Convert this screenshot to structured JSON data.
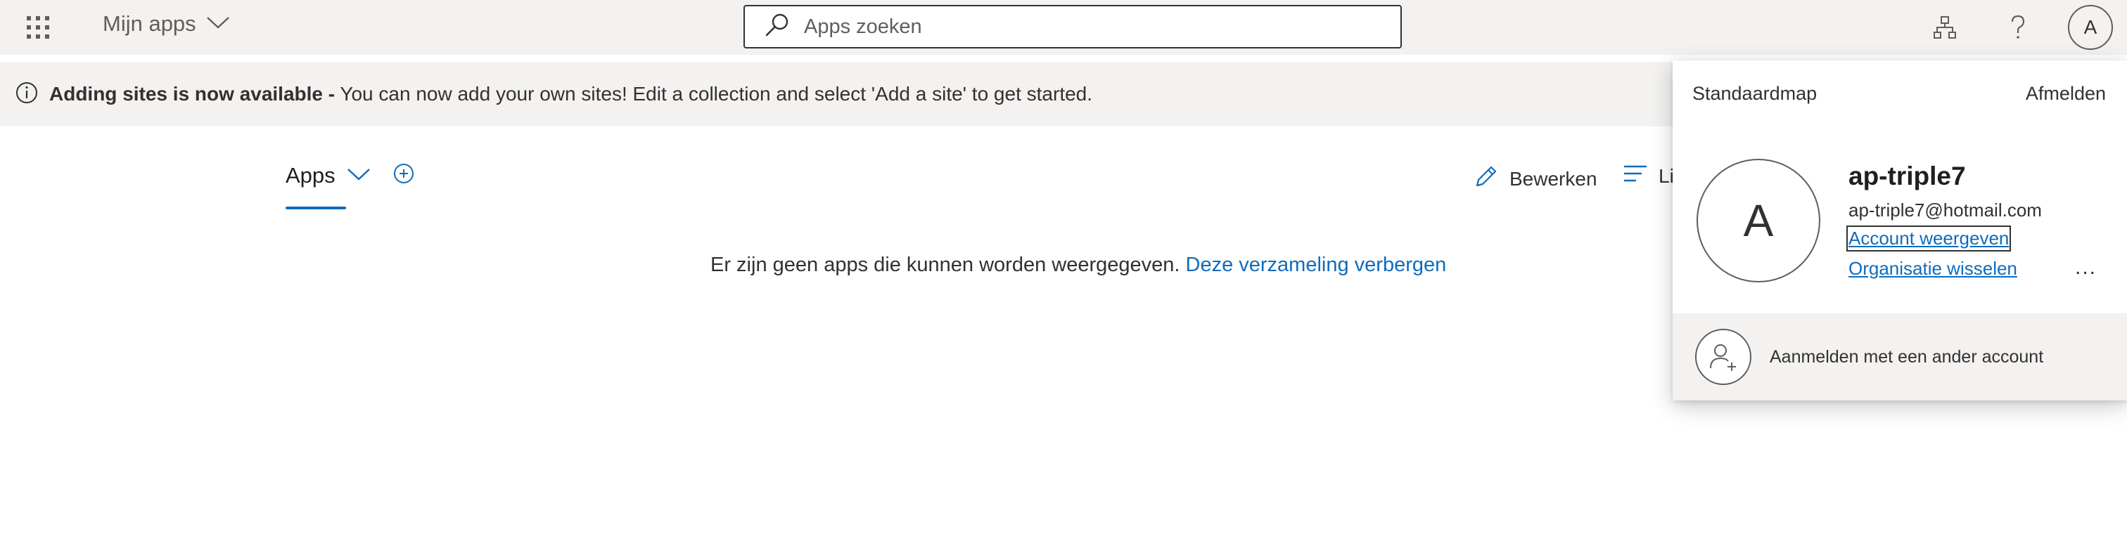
{
  "header": {
    "app_title": "Mijn apps",
    "search_placeholder": "Apps zoeken",
    "avatar_initial": "A",
    "icons": [
      "waffle-icon",
      "chevron-down-icon",
      "search-icon",
      "org-chart-icon",
      "help-icon"
    ]
  },
  "banner": {
    "bold_text": "Adding sites is now available -",
    "text": " You can now add your own sites! Edit a collection and select 'Add a site' to get started."
  },
  "main": {
    "tab_label": "Apps",
    "edit_label": "Bewerken",
    "list_label": "Li",
    "empty_text": "Er zijn geen apps die kunnen worden weergegeven.",
    "hide_collection_link": "Deze verzameling verbergen"
  },
  "account_panel": {
    "organization": "Standaardmap",
    "sign_out": "Afmelden",
    "avatar_initial": "A",
    "user_name": "ap-triple7",
    "email": "ap-triple7@hotmail.com",
    "view_account": "Account weergeven",
    "switch_org": "Organisatie wisselen",
    "more": "...",
    "other_account": "Aanmelden met een ander account"
  },
  "colors": {
    "accent": "#0f6cbd",
    "header_bg": "#f3f2f1",
    "text": "#323130"
  }
}
